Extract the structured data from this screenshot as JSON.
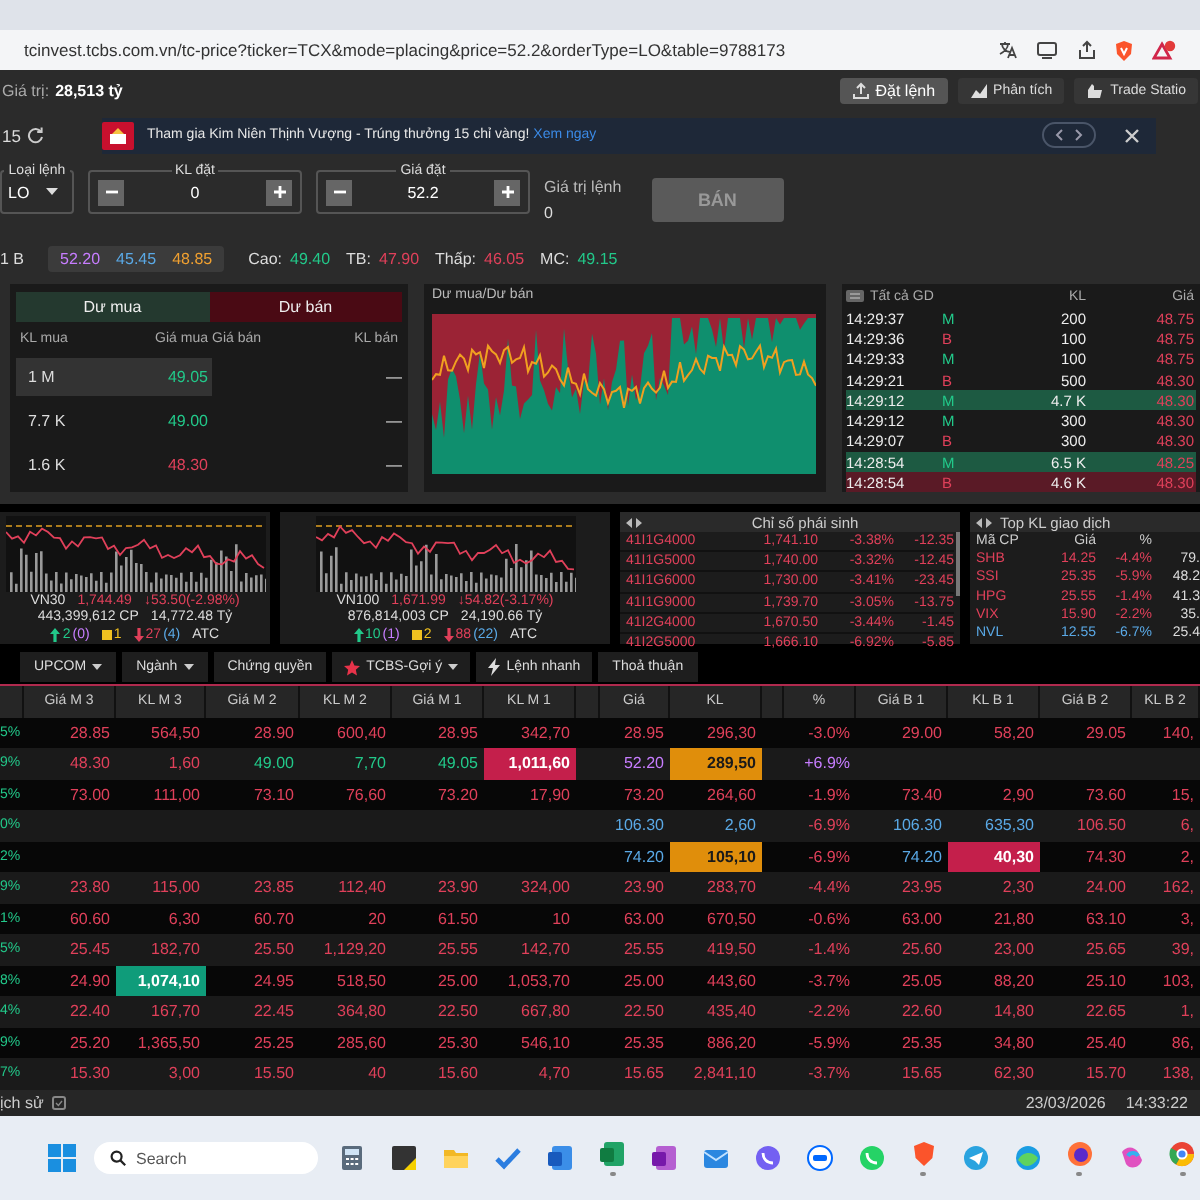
{
  "browser": {
    "url": "tcinvest.tcbs.com.vn/tc-price?ticker=TCX&mode=placing&price=52.2&orderType=LO&table=9788173"
  },
  "header": {
    "value_label": "Giá trị:",
    "value": "28,513 tỷ",
    "buttons": [
      {
        "label": "Đặt lệnh",
        "kind": "order",
        "selected": true
      },
      {
        "label": "Phân tích",
        "kind": "analysis",
        "selected": false
      },
      {
        "label": "Trade Statio",
        "kind": "station",
        "selected": false
      }
    ]
  },
  "banner": {
    "count": "15",
    "text": "Tham gia Kim Niên Thịnh Vượng - Trúng thưởng 15 chỉ vàng!",
    "link": "Xem ngay"
  },
  "order_form": {
    "order_type": {
      "label": "Loại lệnh",
      "value": "LO"
    },
    "quantity": {
      "label": "KL đặt",
      "value": "0"
    },
    "price": {
      "label": "Giá đặt",
      "value": "52.2"
    },
    "order_value": {
      "label": "Giá trị lệnh",
      "value": "0"
    },
    "submit": {
      "label": "BÁN",
      "disabled": true
    }
  },
  "quote": {
    "volume": "1 B",
    "prices": [
      {
        "text": "52.20",
        "color": "#c77dff"
      },
      {
        "text": "45.45",
        "color": "#5aa9e6"
      },
      {
        "text": "48.85",
        "color": "#f0a030"
      }
    ],
    "stats": [
      {
        "label": "Cao:",
        "value": "49.40",
        "color": "#22c98a"
      },
      {
        "label": "TB:",
        "value": "47.90",
        "color": "#e0405a"
      },
      {
        "label": "Thấp:",
        "value": "46.05",
        "color": "#e0405a"
      },
      {
        "label": "MC:",
        "value": "49.15",
        "color": "#22c98a"
      }
    ]
  },
  "order_book": {
    "tabs": [
      {
        "label": "Dư mua",
        "kind": "buy"
      },
      {
        "label": "Dư bán",
        "kind": "sell"
      }
    ],
    "columns": [
      "KL mua",
      "Giá mua",
      "Giá bán",
      "KL bán"
    ],
    "rows": [
      {
        "bid_volume": "1 M",
        "bid_price": "49.05",
        "color": "#22c98a",
        "ask_volume": "—",
        "selected": true
      },
      {
        "bid_volume": "7.7 K",
        "bid_price": "49.00",
        "color": "#22c98a",
        "ask_volume": "—",
        "selected": false
      },
      {
        "bid_volume": "1.6 K",
        "bid_price": "48.30",
        "color": "#e0405a",
        "ask_volume": "—",
        "selected": false
      }
    ]
  },
  "depth_chart": {
    "title": "Dư mua/Dư bán"
  },
  "trades": {
    "columns": [
      "Tất cả GD",
      "KL",
      "Giá"
    ],
    "rows": [
      {
        "time": "14:29:37",
        "side": "M",
        "kind": "buy",
        "volume": "200",
        "price": "48.75",
        "highlight": false
      },
      {
        "time": "14:29:36",
        "side": "B",
        "kind": "sell",
        "volume": "100",
        "price": "48.75",
        "highlight": false
      },
      {
        "time": "14:29:33",
        "side": "M",
        "kind": "buy",
        "volume": "100",
        "price": "48.75",
        "highlight": false
      },
      {
        "time": "14:29:21",
        "side": "B",
        "kind": "sell",
        "volume": "500",
        "price": "48.30",
        "highlight": false
      },
      {
        "time": "14:29:12",
        "side": "M",
        "kind": "buy",
        "volume": "4.7 K",
        "price": "48.30",
        "highlight": true
      },
      {
        "time": "14:29:12",
        "side": "M",
        "kind": "buy",
        "volume": "300",
        "price": "48.30",
        "highlight": false
      },
      {
        "time": "14:29:07",
        "side": "B",
        "kind": "sell",
        "volume": "300",
        "price": "48.30",
        "highlight": false
      },
      {
        "time": "14:28:54",
        "side": "M",
        "kind": "buy",
        "volume": "6.5 K",
        "price": "48.25",
        "highlight": true
      },
      {
        "time": "14:28:54",
        "side": "B",
        "kind": "sell",
        "volume": "4.6 K",
        "price": "48.30",
        "highlight": true
      }
    ]
  },
  "indices": [
    {
      "name": "VN30",
      "value": "1,744.49",
      "change": "↓53.50(-2.98%)",
      "volume": "443,399,612 CP",
      "turnover": "14,772.48 Tỷ",
      "breadth": [
        {
          "kind": "up",
          "count": "2",
          "extra": "(0)"
        },
        {
          "kind": "flat",
          "count": "1"
        },
        {
          "kind": "down",
          "count": "27",
          "extra": "(4)"
        }
      ],
      "session": "ATC"
    },
    {
      "name": "VN100",
      "value": "1,671.99",
      "change": "↓54.82(-3.17%)",
      "volume": "876,814,003 CP",
      "turnover": "24,190.66 Tỷ",
      "breadth": [
        {
          "kind": "up",
          "count": "10",
          "extra": "(1)"
        },
        {
          "kind": "flat",
          "count": "2"
        },
        {
          "kind": "down",
          "count": "88",
          "extra": "(22)"
        }
      ],
      "session": "ATC"
    }
  ],
  "derivatives": {
    "title": "Chỉ số phái sinh",
    "rows": [
      {
        "code": "41I1G4000",
        "price": "1,741.10",
        "percent": "-3.38%",
        "change": "-12.35"
      },
      {
        "code": "41I1G5000",
        "price": "1,740.00",
        "percent": "-3.32%",
        "change": "-12.45"
      },
      {
        "code": "41I1G6000",
        "price": "1,730.00",
        "percent": "-3.41%",
        "change": "-23.45"
      },
      {
        "code": "41I1G9000",
        "price": "1,739.70",
        "percent": "-3.05%",
        "change": "-13.75"
      },
      {
        "code": "41I2G4000",
        "price": "1,670.50",
        "percent": "-3.44%",
        "change": "-1.45"
      },
      {
        "code": "41I2G5000",
        "price": "1,666.10",
        "percent": "-6.92%",
        "change": "-5.85"
      }
    ]
  },
  "top_volume": {
    "title": "Top KL giao dịch",
    "columns": [
      "Mã CP",
      "Giá",
      "%"
    ],
    "rows": [
      {
        "symbol": "SHB",
        "price": "14.25",
        "percent": "-4.4%",
        "volume": "79.",
        "color": "#e0405a"
      },
      {
        "symbol": "SSI",
        "price": "25.35",
        "percent": "-5.9%",
        "volume": "48.2",
        "color": "#e0405a"
      },
      {
        "symbol": "HPG",
        "price": "25.55",
        "percent": "-1.4%",
        "volume": "41.3",
        "color": "#e0405a"
      },
      {
        "symbol": "VIX",
        "price": "15.90",
        "percent": "-2.2%",
        "volume": "35.",
        "color": "#e0405a"
      },
      {
        "symbol": "NVL",
        "price": "12.55",
        "percent": "-6.7%",
        "volume": "25.4",
        "color": "#5aa9e6"
      }
    ]
  },
  "board_tabs": [
    {
      "label": "UPCOM",
      "kind": "plain",
      "dropdown": true
    },
    {
      "label": "Ngành",
      "kind": "plain",
      "dropdown": true
    },
    {
      "label": "Chứng quyền",
      "kind": "plain",
      "dropdown": false
    },
    {
      "label": "TCBS-Gợi ý",
      "kind": "favorite",
      "dropdown": true
    },
    {
      "label": "Lệnh nhanh",
      "kind": "quick",
      "dropdown": false
    },
    {
      "label": "Thoả thuận",
      "kind": "plain",
      "dropdown": false
    }
  ],
  "board": {
    "columns": [
      "Giá M 3",
      "KL M 3",
      "Giá M 2",
      "KL M 2",
      "Giá M 1",
      "KL M 1",
      "Giá",
      "KL",
      "%",
      "Giá B 1",
      "KL B 1",
      "Giá B 2",
      "KL B 2"
    ],
    "rows": [
      {
        "lead": "5%",
        "color": "#e0405a",
        "cells": [
          "28.85",
          "564,50",
          "28.90",
          "600,40",
          "28.95",
          "342,70",
          "28.95",
          "296,30",
          "-3.0%",
          "29.00",
          "58,20",
          "29.05",
          "140,"
        ]
      },
      {
        "lead": "9%",
        "color": "#e0405a",
        "cells": [
          "48.30",
          "1,60",
          {
            "text": "49.00",
            "color": "#22c98a"
          },
          {
            "text": "7,70",
            "color": "#22c98a"
          },
          {
            "text": "49.05",
            "color": "#22c98a"
          },
          {
            "text": "1,011,60",
            "kind": "drop"
          },
          {
            "text": "52.20",
            "color": "#c77dff"
          },
          {
            "text": "289,50",
            "kind": "match"
          },
          {
            "text": "+6.9%",
            "color": "#c77dff"
          },
          null,
          null,
          null,
          null
        ]
      },
      {
        "lead": "5%",
        "color": "#e0405a",
        "cells": [
          "73.00",
          "111,00",
          "73.10",
          "76,60",
          "73.20",
          "17,90",
          "73.20",
          "264,60",
          "-1.9%",
          "73.40",
          "2,90",
          "73.60",
          "15,"
        ]
      },
      {
        "lead": "0%",
        "color": "#e0405a",
        "cells": [
          null,
          null,
          null,
          null,
          null,
          null,
          {
            "text": "106.30",
            "color": "#5aa9e6"
          },
          {
            "text": "2,60",
            "color": "#5aa9e6"
          },
          "-6.9%",
          {
            "text": "106.30",
            "color": "#5aa9e6"
          },
          {
            "text": "635,30",
            "color": "#5aa9e6"
          },
          "106.50",
          "6,"
        ]
      },
      {
        "lead": "2%",
        "color": "#e0405a",
        "cells": [
          null,
          null,
          null,
          null,
          null,
          null,
          {
            "text": "74.20",
            "color": "#5aa9e6"
          },
          {
            "text": "105,10",
            "kind": "match"
          },
          "-6.9%",
          {
            "text": "74.20",
            "color": "#5aa9e6"
          },
          {
            "text": "40,30",
            "kind": "drop"
          },
          "74.30",
          "2,"
        ]
      },
      {
        "lead": "9%",
        "color": "#e0405a",
        "cells": [
          "23.80",
          "115,00",
          "23.85",
          "112,40",
          "23.90",
          "324,00",
          "23.90",
          "283,70",
          "-4.4%",
          "23.95",
          "2,30",
          "24.00",
          "162,"
        ]
      },
      {
        "lead": "1%",
        "color": "#e0405a",
        "cells": [
          "60.60",
          "6,30",
          "60.70",
          "20",
          "61.50",
          "10",
          "63.00",
          "670,50",
          "-0.6%",
          "63.00",
          "21,80",
          "63.10",
          "3,"
        ]
      },
      {
        "lead": "5%",
        "color": "#e0405a",
        "cells": [
          "25.45",
          "182,70",
          "25.50",
          "1,129,20",
          "25.55",
          "142,70",
          "25.55",
          "419,50",
          "-1.4%",
          "25.60",
          "23,00",
          "25.65",
          "39,"
        ]
      },
      {
        "lead": "8%",
        "color": "#e0405a",
        "cells": [
          "24.90",
          {
            "text": "1,074,10",
            "kind": "rise"
          },
          "24.95",
          "518,50",
          "25.00",
          "1,053,70",
          "25.00",
          "443,60",
          "-3.7%",
          "25.05",
          "88,20",
          "25.10",
          "103,"
        ]
      },
      {
        "lead": "4%",
        "color": "#e0405a",
        "cells": [
          "22.40",
          "167,70",
          "22.45",
          "364,80",
          "22.50",
          "667,80",
          "22.50",
          "435,40",
          "-2.2%",
          "22.60",
          "14,80",
          "22.65",
          "1,"
        ]
      },
      {
        "lead": "9%",
        "color": "#e0405a",
        "cells": [
          "25.20",
          "1,365,50",
          "25.25",
          "285,60",
          "25.30",
          "546,10",
          "25.35",
          "886,20",
          "-5.9%",
          "25.35",
          "34,80",
          "25.40",
          "86,"
        ]
      },
      {
        "lead": "7%",
        "color": "#e0405a",
        "cells": [
          "15.30",
          "3,00",
          "15.50",
          "40",
          "15.60",
          "4,70",
          "15.65",
          "2,841,10",
          "-3.7%",
          "15.65",
          "62,30",
          "15.70",
          "138,"
        ]
      }
    ]
  },
  "status_bar": {
    "history": "ịch sử",
    "date": "23/03/2026",
    "time": "14:33:22"
  },
  "taskbar": {
    "search_placeholder": "Search",
    "apps": [
      {
        "kind": "calculator",
        "running": false
      },
      {
        "kind": "note",
        "running": false
      },
      {
        "kind": "folder",
        "running": false
      },
      {
        "kind": "check",
        "running": false
      },
      {
        "kind": "doc-blue",
        "running": false
      },
      {
        "kind": "doc-green",
        "running": true
      },
      {
        "kind": "doc-purple",
        "running": false
      },
      {
        "kind": "mail",
        "running": false
      },
      {
        "kind": "phone-purple",
        "running": false
      },
      {
        "kind": "chat-blue",
        "running": false
      },
      {
        "kind": "phone-green",
        "running": false
      },
      {
        "kind": "shield",
        "running": true
      },
      {
        "kind": "plane",
        "running": false
      },
      {
        "kind": "wave",
        "running": false
      },
      {
        "kind": "fox",
        "running": true
      },
      {
        "kind": "swirl",
        "running": false
      },
      {
        "kind": "ball",
        "running": true
      }
    ]
  }
}
